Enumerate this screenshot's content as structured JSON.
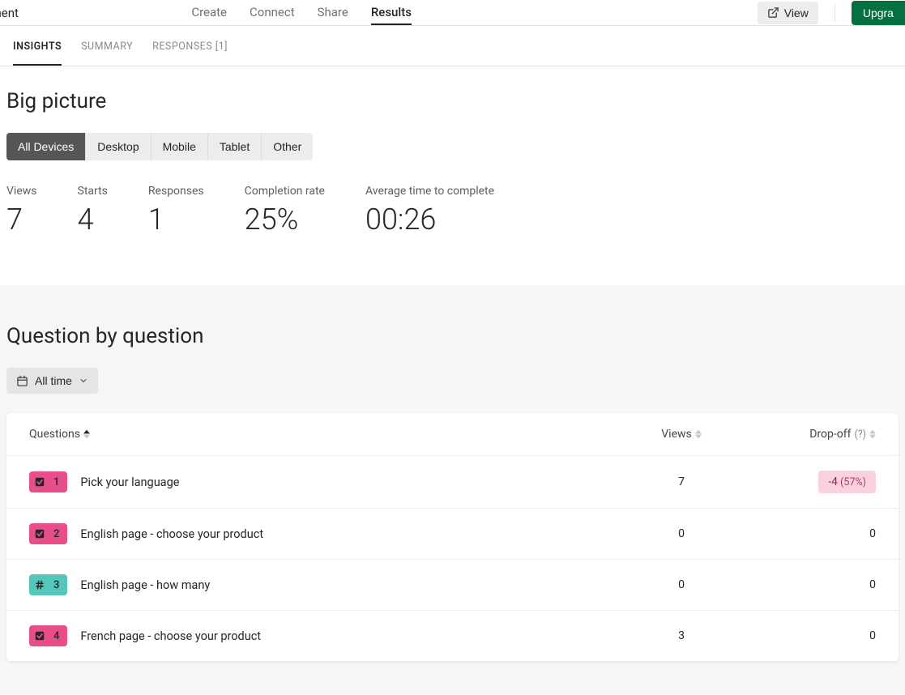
{
  "topbar": {
    "left_truncated_title": "to payment",
    "tabs": [
      {
        "label": "Create",
        "active": false
      },
      {
        "label": "Connect",
        "active": false
      },
      {
        "label": "Share",
        "active": false
      },
      {
        "label": "Results",
        "active": true
      }
    ],
    "view_label": "View",
    "upgrade_label": "Upgra"
  },
  "subtabs": [
    {
      "label": "INSIGHTS",
      "active": true
    },
    {
      "label": "SUMMARY",
      "active": false
    },
    {
      "label": "RESPONSES [1]",
      "active": false
    }
  ],
  "big_picture": {
    "title": "Big picture",
    "device_tabs": [
      {
        "label": "All Devices",
        "active": true
      },
      {
        "label": "Desktop",
        "active": false
      },
      {
        "label": "Mobile",
        "active": false
      },
      {
        "label": "Tablet",
        "active": false
      },
      {
        "label": "Other",
        "active": false
      }
    ],
    "stats": [
      {
        "label": "Views",
        "value": "7"
      },
      {
        "label": "Starts",
        "value": "4"
      },
      {
        "label": "Responses",
        "value": "1"
      },
      {
        "label": "Completion rate",
        "value": "25%"
      },
      {
        "label": "Average time to complete",
        "value": "00:26"
      }
    ]
  },
  "qbq": {
    "title": "Question by question",
    "filter_label": "All time",
    "columns": {
      "questions": "Questions",
      "views": "Views",
      "dropoff": "Drop-off",
      "dropoff_hint": "(?)"
    },
    "rows": [
      {
        "num": "1",
        "icon": "check",
        "color": "pink",
        "title": "Pick your language",
        "views": "7",
        "dropoff": "-4",
        "dropoff_pct": "(57%)",
        "highlight": true
      },
      {
        "num": "2",
        "icon": "check",
        "color": "pink",
        "title": "English page - choose your product",
        "views": "0",
        "dropoff": "0",
        "dropoff_pct": "",
        "highlight": false
      },
      {
        "num": "3",
        "icon": "hash",
        "color": "teal",
        "title": "English page - how many",
        "views": "0",
        "dropoff": "0",
        "dropoff_pct": "",
        "highlight": false
      },
      {
        "num": "4",
        "icon": "check",
        "color": "pink",
        "title": "French page - choose your product",
        "views": "3",
        "dropoff": "0",
        "dropoff_pct": "",
        "highlight": false
      }
    ]
  }
}
